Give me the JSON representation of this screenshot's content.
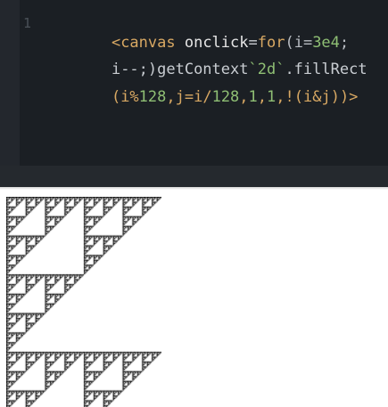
{
  "editor": {
    "line_number": "1",
    "line1": {
      "t1": "<canvas",
      "t2": " onclick",
      "t3": "=",
      "t4": "for",
      "t5": "(i=",
      "t6": "3e4",
      "t7": ";"
    },
    "line2": {
      "t1": "i--;)getContext",
      "t2": "`2d`",
      "t3": ".fillRect"
    },
    "line3": {
      "t1": "(i%",
      "t2": "128",
      "t3": ",j=i/",
      "t4": "128",
      "t5": ",",
      "t6": "1",
      "t7": ",",
      "t8": "1",
      "t9": ",!(i&j))>"
    }
  },
  "colors": {
    "editor_bg": "#1b1f24",
    "tag": "#d8a863",
    "number": "#8fbf74",
    "text": "#c9cdd2",
    "fractal": "#000000"
  },
  "output": {
    "fractal_modulus": 128,
    "fractal_iterations": 30000
  }
}
